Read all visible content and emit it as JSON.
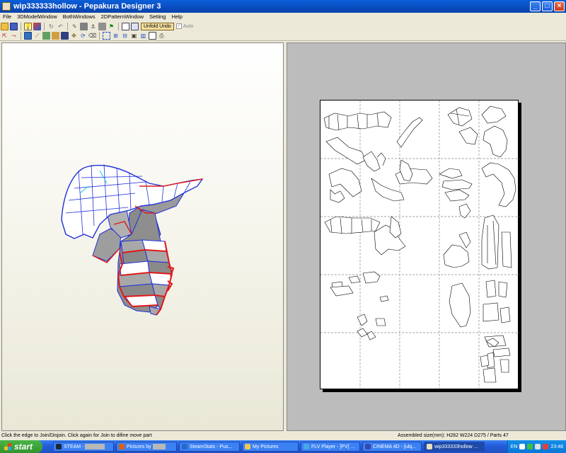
{
  "window": {
    "title": "wip333333hollow - Pepakura Designer 3"
  },
  "window_buttons": {
    "minimize": "_",
    "maximize": "□",
    "close": "×"
  },
  "menu": [
    "File",
    "3DModelWindow",
    "BothWindows",
    "2DPatternWindow",
    "Setting",
    "Help"
  ],
  "toolbar": {
    "unfold_undo": "Unfold Undo",
    "auto_label": "Auto",
    "auto_checked": true
  },
  "status": {
    "hint": "Click the edge to Join/Disjoin. Click again for Join to difine move part",
    "assembled": "Assembled size(mm): H282 W224 D275 / Parts 47"
  },
  "taskbar": {
    "start_label": "start",
    "tasks": [
      {
        "label": "STEAM - ",
        "icon_color": "#1c2838"
      },
      {
        "label": "Pictures by",
        "icon_color": "#d86018"
      },
      {
        "label": "SteamStats - Pus...",
        "icon_color": "#2868c8"
      },
      {
        "label": "My Pictures",
        "icon_color": "#f0c850"
      },
      {
        "label": "FLV Player - [PV] ...",
        "icon_color": "#48a8e8"
      },
      {
        "label": "CINEMA 4D - [ulq...",
        "icon_color": "#3848a8"
      },
      {
        "label": "wip333333hollow ...",
        "icon_color": "#e8e0c0",
        "active": true
      }
    ],
    "tray": {
      "lang": "EN",
      "clock": "23:48"
    }
  },
  "colors": {
    "cut_red": "#e01818",
    "mesh_blue": "#2030d8",
    "face_gray": "#9a9a9a",
    "face_dark": "#7a7a7a",
    "face_white": "#ffffff",
    "paper_bg": "#ffffff",
    "workspace_gray": "#bcbcbc"
  }
}
